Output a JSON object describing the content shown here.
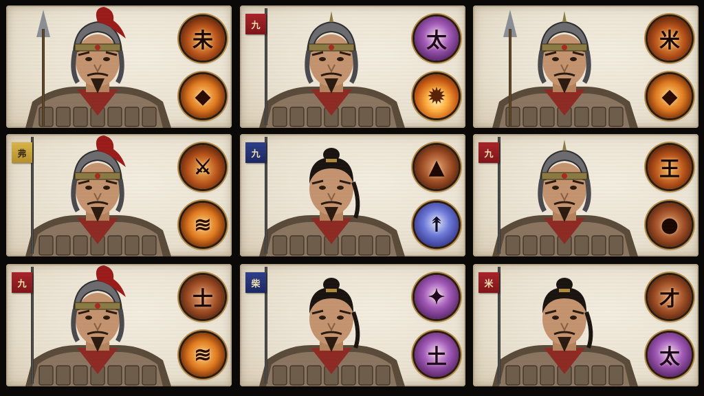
{
  "cards": [
    {
      "id": "card-1",
      "flag": null,
      "spear": true,
      "skills": [
        {
          "style": "ember",
          "glyph": "未",
          "icon": "sword-glyph-icon"
        },
        {
          "style": "fire",
          "glyph": "◆",
          "icon": "blade-crest-icon"
        }
      ]
    },
    {
      "id": "card-2",
      "flag": {
        "text": "九",
        "color": "red"
      },
      "spear": false,
      "skills": [
        {
          "style": "violet",
          "glyph": "太",
          "icon": "spirit-glyph-icon"
        },
        {
          "style": "blaze",
          "glyph": "✹",
          "icon": "burst-icon"
        }
      ]
    },
    {
      "id": "card-3",
      "flag": null,
      "spear": true,
      "skills": [
        {
          "style": "ember",
          "glyph": "米",
          "icon": "star-glyph-icon"
        },
        {
          "style": "fire",
          "glyph": "◆",
          "icon": "blade-crest-icon"
        }
      ]
    },
    {
      "id": "card-4",
      "flag": {
        "text": "弗",
        "color": "yellow"
      },
      "spear": false,
      "skills": [
        {
          "style": "ember",
          "glyph": "⚔",
          "icon": "slash-icon"
        },
        {
          "style": "fire",
          "glyph": "≋",
          "icon": "flame-wave-icon"
        }
      ]
    },
    {
      "id": "card-5",
      "flag": {
        "text": "九",
        "color": "blue"
      },
      "spear": false,
      "skills": [
        {
          "style": "rust",
          "glyph": "▲",
          "icon": "mountain-icon"
        },
        {
          "style": "azure",
          "glyph": "↟",
          "icon": "spear-strike-icon"
        }
      ]
    },
    {
      "id": "card-6",
      "flag": {
        "text": "九",
        "color": "red"
      },
      "spear": false,
      "skills": [
        {
          "style": "ember",
          "glyph": "王",
          "icon": "king-glyph-icon"
        },
        {
          "style": "rust",
          "glyph": "●",
          "icon": "meteor-icon"
        }
      ]
    },
    {
      "id": "card-7",
      "flag": {
        "text": "九",
        "color": "red"
      },
      "spear": false,
      "skills": [
        {
          "style": "rust",
          "glyph": "士",
          "icon": "soldier-glyph-icon"
        },
        {
          "style": "fire",
          "glyph": "≋",
          "icon": "flame-wave-icon"
        }
      ]
    },
    {
      "id": "card-8",
      "flag": {
        "text": "柴",
        "color": "blue"
      },
      "spear": false,
      "skills": [
        {
          "style": "violet",
          "glyph": "✦",
          "icon": "shard-icon"
        },
        {
          "style": "violet",
          "glyph": "土",
          "icon": "earth-glyph-icon"
        }
      ]
    },
    {
      "id": "card-9",
      "flag": {
        "text": "米",
        "color": "red"
      },
      "spear": false,
      "skills": [
        {
          "style": "rust",
          "glyph": "才",
          "icon": "talent-glyph-icon"
        },
        {
          "style": "violet",
          "glyph": "太",
          "icon": "spirit-glyph-icon"
        }
      ]
    }
  ]
}
